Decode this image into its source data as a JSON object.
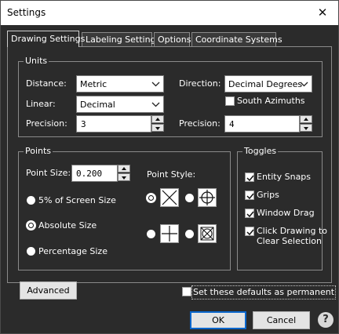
{
  "window": {
    "title": "Settings",
    "close_glyph": "✕"
  },
  "tabs": [
    {
      "label": "Drawing Settings",
      "active": true
    },
    {
      "label": "Labeling Settings",
      "active": false
    },
    {
      "label": "Options",
      "active": false
    },
    {
      "label": "Coordinate Systems",
      "active": false
    }
  ],
  "units": {
    "legend": "Units",
    "distance": {
      "label": "Distance:",
      "value": "Metric"
    },
    "linear": {
      "label": "Linear:",
      "value": "Decimal"
    },
    "precision_left": {
      "label": "Precision:",
      "value": "3"
    },
    "direction": {
      "label": "Direction:",
      "value": "Decimal Degrees"
    },
    "south_azimuths": {
      "label": "South Azimuths",
      "checked": false
    },
    "precision_right": {
      "label": "Precision:",
      "value": "4"
    }
  },
  "points": {
    "legend": "Points",
    "point_size": {
      "label": "Point Size:",
      "value": "0.200"
    },
    "size_modes": [
      {
        "label": "5% of Screen Size",
        "selected": false
      },
      {
        "label": "Absolute Size",
        "selected": true
      },
      {
        "label": "Percentage Size",
        "selected": false
      }
    ],
    "point_style_label": "Point Style:",
    "styles": [
      {
        "icon": "x-in-box",
        "selected": true
      },
      {
        "icon": "circle-crosshair",
        "selected": false
      },
      {
        "icon": "plus-in-box",
        "selected": false
      },
      {
        "icon": "x-in-circle-box",
        "selected": false
      }
    ]
  },
  "toggles": {
    "legend": "Toggles",
    "items": [
      {
        "label": "Entity Snaps",
        "checked": true
      },
      {
        "label": "Grips",
        "checked": true
      },
      {
        "label": "Window Drag",
        "checked": true
      },
      {
        "label_line1": "Click Drawing to",
        "label_line2": "Clear Selection",
        "checked": true
      }
    ]
  },
  "advanced_label": "Advanced",
  "permanent_defaults": {
    "label": "Set these defaults as permanent",
    "checked": false
  },
  "ok_label": "OK",
  "cancel_label": "Cancel",
  "help_glyph": "?"
}
